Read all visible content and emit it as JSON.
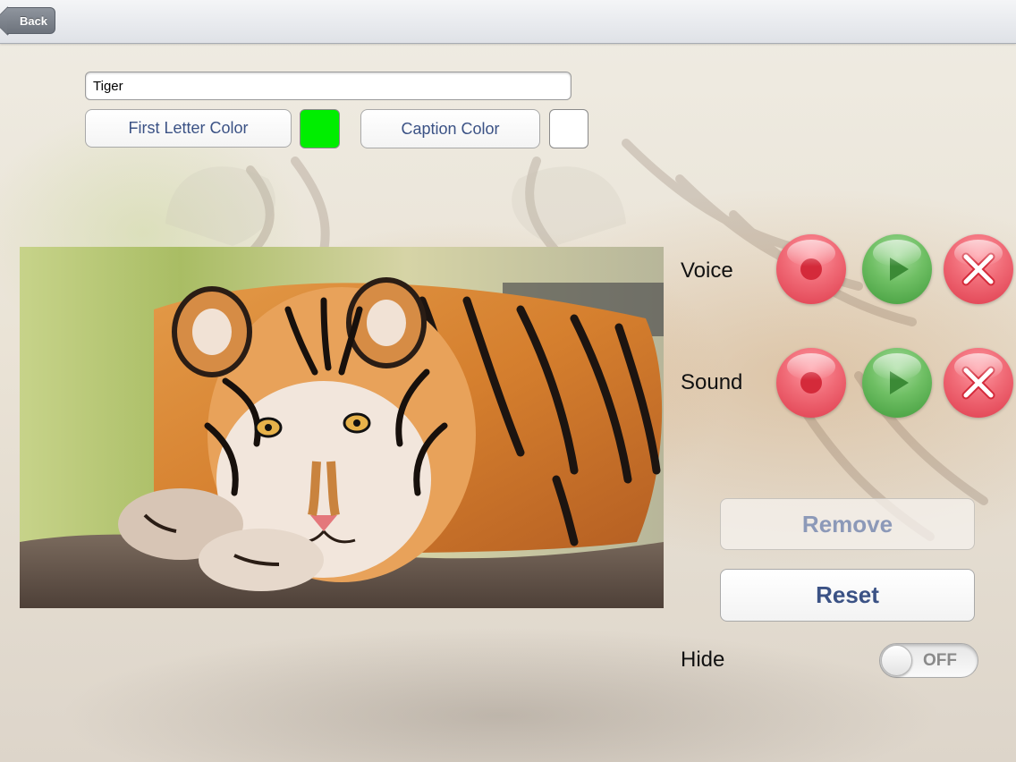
{
  "navbar": {
    "back_label": "Back"
  },
  "caption": {
    "name_value": "Tiger"
  },
  "colors": {
    "first_letter_button_label": "First Letter Color",
    "first_letter_color": "#00ee00",
    "caption_button_label": "Caption Color",
    "caption_color": "#ffffff"
  },
  "audio": {
    "voice_label": "Voice",
    "sound_label": "Sound",
    "controls": [
      "record-icon",
      "play-icon",
      "delete-icon"
    ]
  },
  "actions": {
    "remove_label": "Remove",
    "reset_label": "Reset"
  },
  "hide": {
    "label": "Hide",
    "state_text": "OFF"
  },
  "accents": {
    "button_text": "#3b5285",
    "record_red": "#e84a5a",
    "play_green": "#5fb055"
  }
}
